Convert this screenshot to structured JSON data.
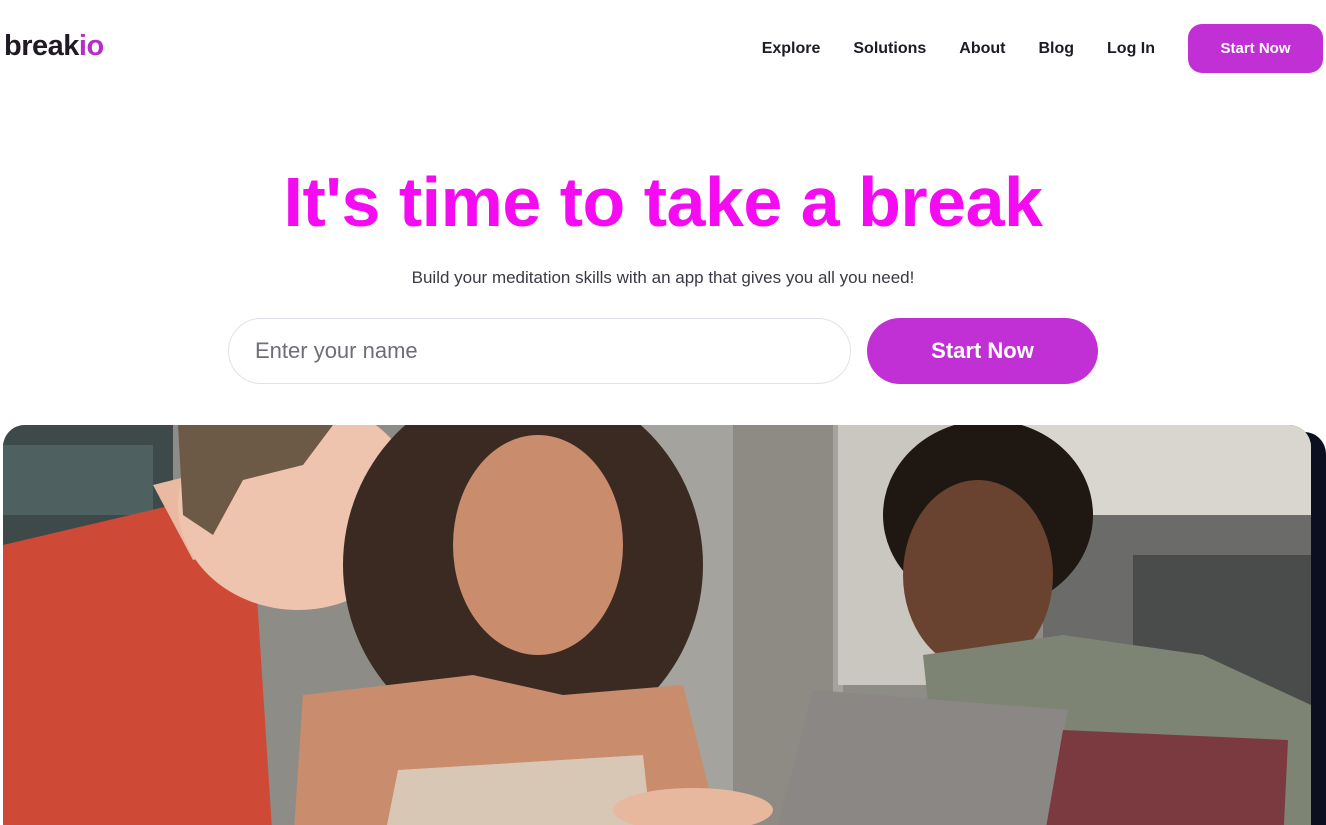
{
  "brand": {
    "name_main": "break",
    "name_accent": "io",
    "accent_color": "#b62dc9"
  },
  "nav": {
    "links": [
      "Explore",
      "Solutions",
      "About",
      "Blog",
      "Log In"
    ],
    "cta_label": "Start Now"
  },
  "hero": {
    "title": "It's time to take a break",
    "title_color": "#f40bf2",
    "subtitle": "Build your meditation skills with an app that gives you all you need!",
    "input_placeholder": "Enter your name",
    "cta_label": "Start Now",
    "cta_color": "#c130d4"
  },
  "image": {
    "alt": "Three young people looking at a laptop together"
  }
}
